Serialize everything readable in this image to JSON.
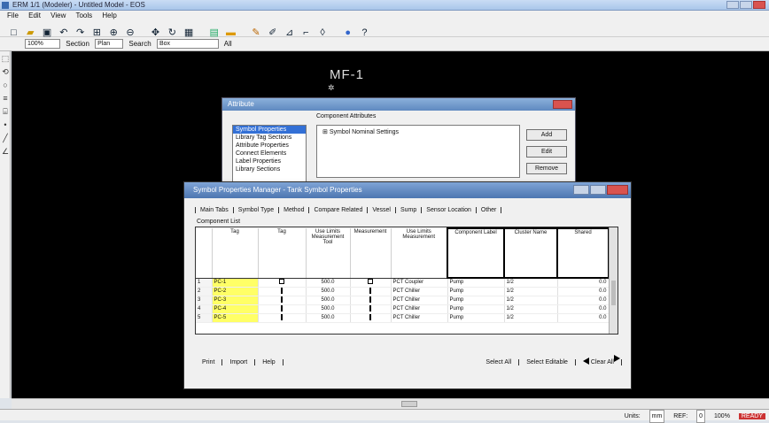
{
  "window": {
    "title": "ERM 1/1 (Modeler) - Untitled Model - EOS"
  },
  "menu": [
    "File",
    "Edit",
    "View",
    "Tools",
    "Help"
  ],
  "toolbar": {
    "zoom_value": "100%",
    "view_label": "Section",
    "view_value": "Plan",
    "search_label": "Search",
    "search_value": "Box",
    "all_label": "All"
  },
  "canvas": {
    "node_label": "MF-1"
  },
  "status": {
    "left": "",
    "units_label": "Units:",
    "units_value": "mm",
    "ref_label": "REF:",
    "ref_value": "0",
    "zoom": "100%",
    "alert": "READY"
  },
  "back_dialog": {
    "title": "Attribute",
    "list_items": [
      "Symbol Properties",
      "Library Tag Sections",
      "Attribute Properties",
      "Connect Elements",
      "Label Properties",
      "Library Sections"
    ],
    "selected_index": 0,
    "group_label": "Component Attributes",
    "tree_item": "Symbol Nominal Settings",
    "buttons": [
      "Add",
      "Edit",
      "Remove"
    ]
  },
  "front_dialog": {
    "title": "Symbol Properties Manager - Tank Symbol Properties",
    "tabs": [
      "Main Tabs",
      "Symbol Type",
      "Method",
      "Compare Related",
      "Vessel",
      "Sump",
      "Sensor Location",
      "Other"
    ],
    "subtitle": "Component List",
    "columns": [
      "Tag",
      "Tag",
      "Use Limits Measurement Tool",
      "Measurement",
      "Use Limits Measurement",
      "Component Label",
      "Cluster Name",
      "Shared",
      "Measurement"
    ],
    "rows": [
      {
        "num": "1",
        "tag": "PC-1",
        "check": true,
        "measure": "500.0",
        "flag": true,
        "label": "PCT Coupler",
        "name": "Pump",
        "shared": "1/2",
        "value": "0.0"
      },
      {
        "num": "2",
        "tag": "PC-2",
        "check": false,
        "measure": "500.0",
        "flag": false,
        "label": "PCT Chiller",
        "name": "Pump",
        "shared": "1/2",
        "value": "0.0"
      },
      {
        "num": "3",
        "tag": "PC-3",
        "check": false,
        "measure": "500.0",
        "flag": false,
        "label": "PCT Chiller",
        "name": "Pump",
        "shared": "1/2",
        "value": "0.0"
      },
      {
        "num": "4",
        "tag": "PC-4",
        "check": false,
        "measure": "500.0",
        "flag": false,
        "label": "PCT Chiller",
        "name": "Pump",
        "shared": "1/2",
        "value": "0.0"
      },
      {
        "num": "5",
        "tag": "PC-5",
        "check": false,
        "measure": "500.0",
        "flag": false,
        "label": "PCT Chiller",
        "name": "Pump",
        "shared": "1/2",
        "value": "0.0"
      }
    ],
    "bottom_left": [
      "Print",
      "Import",
      "Help"
    ],
    "bottom_right": [
      "Select All",
      "Select Editable",
      "Clear All"
    ]
  }
}
